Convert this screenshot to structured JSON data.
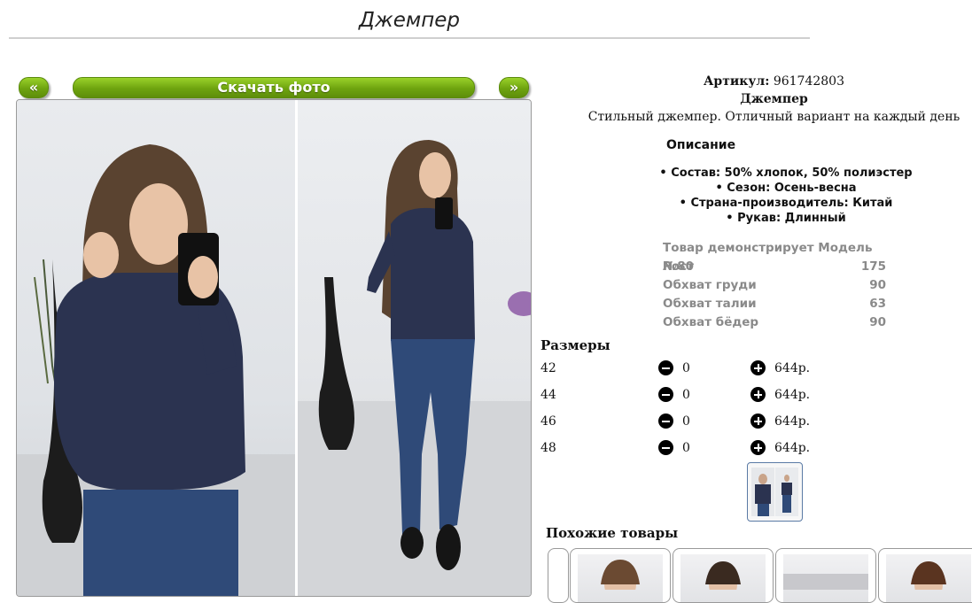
{
  "page": {
    "title": "Джемпер"
  },
  "gallery": {
    "prev_label": "«",
    "download_label": "Скачать фото",
    "next_label": "»"
  },
  "product": {
    "article_label": "Артикул:",
    "article_value": "961742803",
    "name": "Джемпер",
    "tagline": "Стильный джемпер. Отличный вариант на каждый день"
  },
  "description": {
    "heading": "Описание",
    "items": [
      "• Состав: 50% хлопок, 50% полиэстер",
      "• Сезон: Осень-весна",
      "• Страна-производитель: Китай",
      "• Рукав: Длинный"
    ]
  },
  "model": {
    "heading": "Товар демонстрирует Модель №80",
    "rows": [
      {
        "label": "Рост",
        "value": "175"
      },
      {
        "label": "Обхват груди",
        "value": "90"
      },
      {
        "label": "Обхват талии",
        "value": "63"
      },
      {
        "label": "Обхват бёдер",
        "value": "90"
      }
    ]
  },
  "sizes": {
    "title": "Размеры",
    "rows": [
      {
        "size": "42",
        "qty": "0",
        "price": "644р."
      },
      {
        "size": "44",
        "qty": "0",
        "price": "644р."
      },
      {
        "size": "46",
        "qty": "0",
        "price": "644р."
      },
      {
        "size": "48",
        "qty": "0",
        "price": "644р."
      }
    ]
  },
  "similar": {
    "title": "Похожие товары"
  },
  "colors": {
    "accent_green": "#6ea30f",
    "sweater": "#2b3350",
    "jeans": "#2f4a78"
  }
}
